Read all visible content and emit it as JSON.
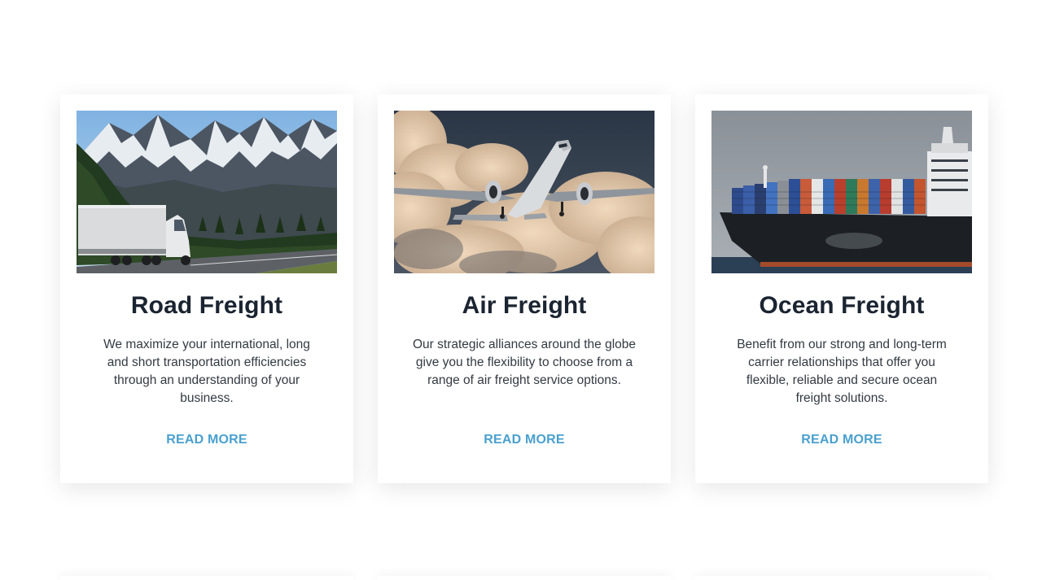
{
  "cards": [
    {
      "title": "Road Freight",
      "text": "We maximize your international, long and short transportation efficiencies through an understanding of your business.",
      "link": "READ MORE",
      "image": "truck-mountains-image"
    },
    {
      "title": "Air Freight",
      "text": "Our strategic alliances around the globe give you the flexibility to choose from a range of air freight service options.",
      "link": "READ MORE",
      "image": "airplane-clouds-image"
    },
    {
      "title": "Ocean Freight",
      "text": "Benefit from our strong and long-term carrier relationships that offer you flexible, reliable and secure ocean freight solutions.",
      "link": "READ MORE",
      "image": "container-ship-image"
    }
  ],
  "colors": {
    "title": "#1b2431",
    "body_text": "#333a42",
    "link": "#4aa0cf",
    "card_background": "#ffffff"
  }
}
